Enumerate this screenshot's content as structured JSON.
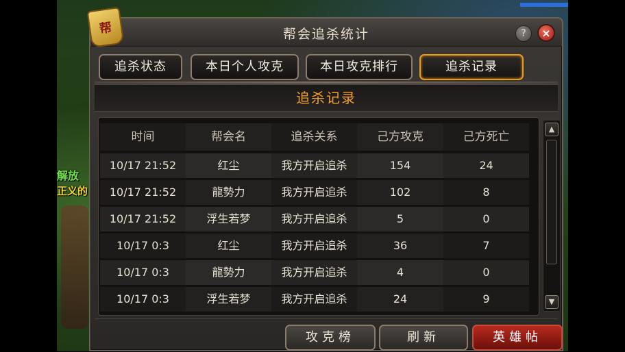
{
  "dialog": {
    "title": "帮会追杀统计",
    "emblem_glyph": "帮",
    "help_label": "?",
    "close_label": "×"
  },
  "tabs": [
    {
      "label": "追杀状态",
      "active": false
    },
    {
      "label": "本日个人攻克",
      "active": false
    },
    {
      "label": "本日攻克排行",
      "active": false
    },
    {
      "label": "追杀记录",
      "active": true
    }
  ],
  "section": {
    "title": "追杀记录"
  },
  "table": {
    "headers": [
      "时间",
      "帮会名",
      "追杀关系",
      "己方攻克",
      "己方死亡"
    ],
    "rows": [
      [
        "10/17 21:52",
        "红尘",
        "我方开启追杀",
        "154",
        "24"
      ],
      [
        "10/17 21:52",
        "龍勢力",
        "我方开启追杀",
        "102",
        "8"
      ],
      [
        "10/17 21:52",
        "浮生若梦",
        "我方开启追杀",
        "5",
        "0"
      ],
      [
        "10/17 0:3",
        "红尘",
        "我方开启追杀",
        "36",
        "7"
      ],
      [
        "10/17 0:3",
        "龍勢力",
        "我方开启追杀",
        "4",
        "0"
      ],
      [
        "10/17 0:3",
        "浮生若梦",
        "我方开启追杀",
        "24",
        "9"
      ]
    ]
  },
  "scroll": {
    "up": "▲",
    "down": "▼"
  },
  "buttons": {
    "ranking": "攻克榜",
    "refresh": "刷新",
    "hero": "英雄帖"
  },
  "background": {
    "text1": "解放",
    "text2": "正义的"
  }
}
